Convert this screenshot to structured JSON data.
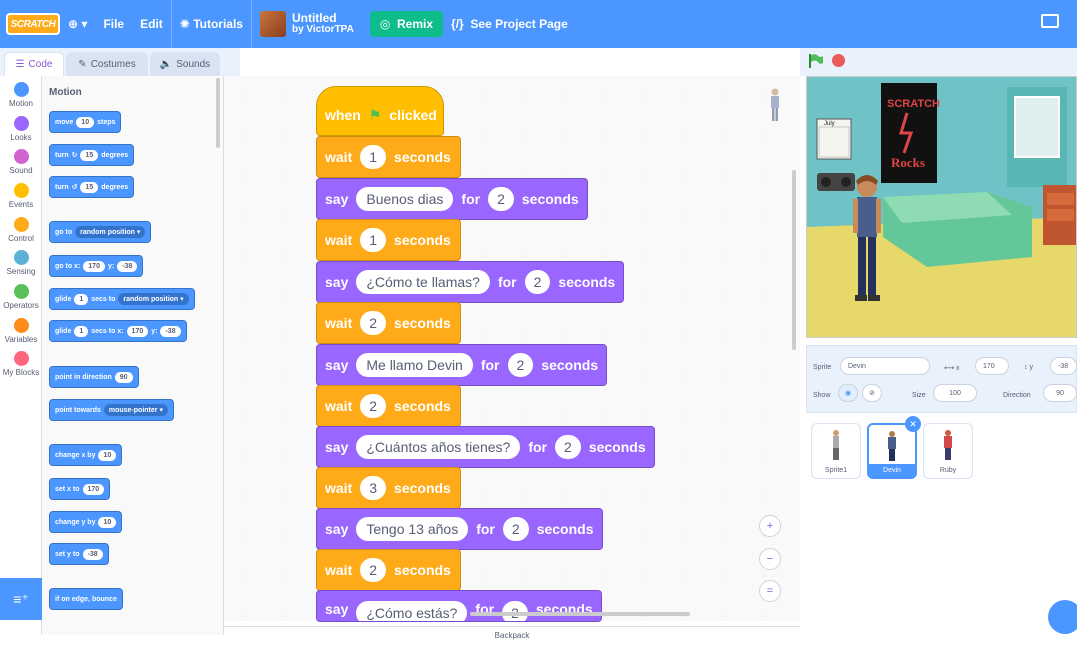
{
  "menubar": {
    "logo": "SCRATCH",
    "file": "File",
    "edit": "Edit",
    "tutorials": "Tutorials",
    "project_title": "Untitled",
    "project_author": "by VictorTPA",
    "remix": "Remix",
    "see_project": "See Project Page"
  },
  "tabs": {
    "code": "Code",
    "costumes": "Costumes",
    "sounds": "Sounds"
  },
  "categories": [
    {
      "label": "Motion",
      "color": "#4c97ff"
    },
    {
      "label": "Looks",
      "color": "#9966ff"
    },
    {
      "label": "Sound",
      "color": "#cf63cf"
    },
    {
      "label": "Events",
      "color": "#ffbf00"
    },
    {
      "label": "Control",
      "color": "#ffab19"
    },
    {
      "label": "Sensing",
      "color": "#5cb1d6"
    },
    {
      "label": "Operators",
      "color": "#59c059"
    },
    {
      "label": "Variables",
      "color": "#ff8c1a"
    },
    {
      "label": "My Blocks",
      "color": "#ff6680"
    }
  ],
  "palette": {
    "title": "Motion",
    "move": "move",
    "move_val": "10",
    "steps": "steps",
    "turn": "turn",
    "turn_r_val": "15",
    "degrees": "degrees",
    "turn_l_val": "15",
    "goto": "go to",
    "goto_dd": "random position",
    "gotoxy": "go to x:",
    "gotoxy_x": "170",
    "y": "y:",
    "gotoxy_y": "-38",
    "glide": "glide",
    "glide_val": "1",
    "secs_to": "secs to",
    "glide_dd": "random position",
    "glide2_val": "1",
    "secs_to_x": "secs to x:",
    "glide2_x": "170",
    "glide2_y": "-38",
    "point_dir": "point in direction",
    "point_dir_val": "90",
    "point_towards": "point towards",
    "point_towards_dd": "mouse-pointer",
    "change_x": "change x by",
    "change_x_val": "10",
    "set_x": "set x to",
    "set_x_val": "170",
    "change_y": "change y by",
    "change_y_val": "10",
    "set_y": "set y to",
    "set_y_val": "-38",
    "bounce": "if on edge, bounce"
  },
  "script": {
    "when": "when",
    "clicked": "clicked",
    "wait": "wait",
    "seconds": "seconds",
    "say": "say",
    "for": "for",
    "w1": "1",
    "say1": "Buenos dias",
    "s1": "2",
    "w2": "1",
    "say2": "¿Cómo te llamas?",
    "s2": "2",
    "w3": "2",
    "say3": "Me llamo Devin",
    "s3": "2",
    "w4": "2",
    "say4": "¿Cuántos años tienes?",
    "s4": "2",
    "w5": "3",
    "say5": "Tengo 13 años",
    "s5": "2",
    "w6": "2",
    "say6": "¿Cómo estás?",
    "s6": "2"
  },
  "zoom": {
    "in": "+",
    "out": "−",
    "reset": "="
  },
  "backpack": "Backpack",
  "stage": {
    "poster_text1": "SCRATCH",
    "poster_text2": "Rocks",
    "calendar": "July"
  },
  "sprite_info": {
    "sprite_label": "Sprite",
    "sprite_name": "Devin",
    "x_label": "x",
    "x_val": "170",
    "y_label": "y",
    "y_val": "-38",
    "show_label": "Show",
    "size_label": "Size",
    "size_val": "100",
    "direction_label": "Direction",
    "direction_val": "90"
  },
  "sprites": [
    "Sprite1",
    "Devin",
    "Ruby"
  ]
}
